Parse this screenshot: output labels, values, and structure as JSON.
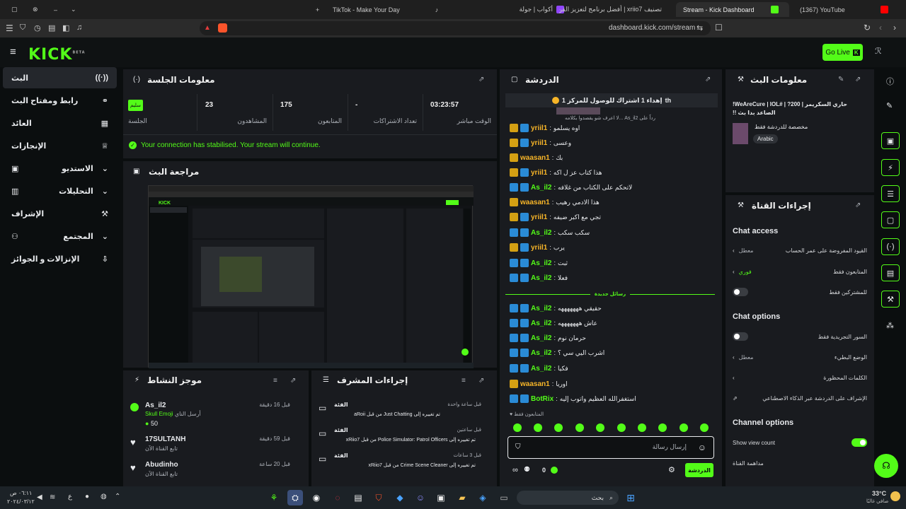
{
  "browser": {
    "tabs": [
      {
        "label": "(1367) YouTube",
        "icon": "youtube-icon",
        "color": "#ff0000"
      },
      {
        "label": "Stream - Kick Dashboard",
        "icon": "kick-icon",
        "color": "#53fc18",
        "active": true
      },
      {
        "label": "تصنيف xriio7 | أفضل برنامج لتعزيز القن...",
        "icon": "rank-icon",
        "color": "#9146ff"
      },
      {
        "label": "أكواب | جولة",
        "icon": "cup-icon",
        "color": "#9146ff"
      },
      {
        "label": "TikTok - Make Your Day",
        "icon": "tiktok-icon",
        "color": "#ffffff"
      }
    ],
    "url": "dashboard.kick.com/stream"
  },
  "header": {
    "logo": "KICK",
    "logo_sup": "BETA",
    "go_live": "Go Live"
  },
  "sidebar": {
    "items": [
      {
        "label": "البث",
        "icon": "broadcast-icon"
      },
      {
        "label": "رابط ومفتاح البث",
        "icon": "link-icon"
      },
      {
        "label": "العائد",
        "icon": "revenue-icon"
      },
      {
        "label": "الإنجازات",
        "icon": "trophy-icon"
      },
      {
        "label": "الاستديو",
        "icon": "studio-icon"
      },
      {
        "label": "التحليلات",
        "icon": "analytics-icon"
      },
      {
        "label": "الإشراف",
        "icon": "moderation-icon"
      },
      {
        "label": "المجتمع",
        "icon": "community-icon"
      },
      {
        "label": "الإنزالات و الجوائز",
        "icon": "drops-icon"
      }
    ]
  },
  "session": {
    "title": "معلومات الجلسة",
    "status_badge": "سليم",
    "status_label": "الجلسة",
    "stats": [
      {
        "value": "23",
        "label": "المشاهدون"
      },
      {
        "value": "175",
        "label": "المتابعون"
      },
      {
        "value": "-",
        "label": "تعداد الاشتراكات"
      },
      {
        "value": "03:23:57",
        "label": "الوقت مباشر"
      }
    ],
    "notice": "Your connection has stabilised. Your stream will continue."
  },
  "preview": {
    "title": "مراجعة البث"
  },
  "activity": {
    "title": "موجز النشاط",
    "items": [
      {
        "user": "As_il2",
        "detail": "أرسل الناي",
        "detail2": "Skull Emoji",
        "amount": "50",
        "time": "قبل 16 دقيقة",
        "icon": "kick-coin-icon"
      },
      {
        "user": "17SULTANH",
        "detail": "تابع القناة الآن",
        "time": "قبل 59 دقيقة",
        "icon": "heart-icon"
      },
      {
        "user": "Abudinho",
        "detail": "تابع القناة الآن",
        "time": "قبل 20 ساعة",
        "icon": "heart-icon"
      }
    ]
  },
  "modactions": {
    "title": "إجراءات المشرف",
    "items": [
      {
        "heading": "الفئة",
        "text": "تم تغييره إلى Just Chatting من قبل aRoii",
        "time": "قبل ساعة واحدة"
      },
      {
        "heading": "الفئة",
        "text": "تم تغييره إلى Police Simulator: Patrol Officers من قبل xRiio7",
        "time": "قبل ساعتين"
      },
      {
        "heading": "الفئة",
        "text": "تم تغييره إلى Crime Scene Cleaner من قبل xRiio7",
        "time": "قبل 3 ساعات"
      }
    ]
  },
  "chat": {
    "title": "الدردشة",
    "pinned": "إهداء 1 اشتراك للوصول للمركز 1",
    "pinned_user": "th",
    "pinned_sub": "لا اعرف شو يقصدوا بكلامه... As_il2 رداً على",
    "new_messages": "رسائل جديدة",
    "messages": [
      {
        "user": "yriil1",
        "text": "اوه يسلمو",
        "color": "#f7b528"
      },
      {
        "user": "yriil1",
        "text": "وعسى",
        "color": "#f7b528"
      },
      {
        "user": "waasan1",
        "text": "بك",
        "color": "#f7b528"
      },
      {
        "user": "yriil1",
        "text": "هذا كتاب عز ل اكه",
        "color": "#f7b528"
      },
      {
        "user": "As_il2",
        "text": "لاتحكم على الكتاب من غلافه",
        "color": "#53fc18"
      },
      {
        "user": "waasan1",
        "text": "هذا الادمي رهيب",
        "color": "#f7b528"
      },
      {
        "user": "yriil1",
        "text": "تجي مع اكبر ضيفه",
        "color": "#f7b528"
      },
      {
        "user": "As_il2",
        "text": "سكب سكب",
        "color": "#53fc18"
      },
      {
        "user": "yriil1",
        "text": "يرب",
        "color": "#f7b528"
      },
      {
        "user": "As_il2",
        "text": "ثبت",
        "color": "#53fc18"
      },
      {
        "user": "As_il2",
        "text": "فعلا",
        "color": "#53fc18"
      },
      {
        "user": "As_il2",
        "text": "حقيقي هههههههه",
        "color": "#53fc18"
      },
      {
        "user": "As_il2",
        "text": "عاش هههههههه",
        "color": "#53fc18"
      },
      {
        "user": "As_il2",
        "text": "حرمان نوم",
        "color": "#53fc18"
      },
      {
        "user": "As_il2",
        "text": "اشرب اليي سي ؟",
        "color": "#53fc18"
      },
      {
        "user": "As_il2",
        "text": "فكيا",
        "color": "#53fc18"
      },
      {
        "user": "waasan1",
        "text": "اوريا",
        "color": "#f7b528"
      },
      {
        "user": "BotRix",
        "text": "استغفرالله العظيم واتوب إليه",
        "color": "#53fc18"
      }
    ],
    "followers_only": "المتابعون فقط",
    "input_placeholder": "إرسال رسالة",
    "send_label": "الدردشة",
    "counter": "0"
  },
  "streaminfo": {
    "title": "معلومات البث",
    "stream_title": "حاري السكريمر | 200? | #WeAreCure | IOL! الصاعد بدا بث !!",
    "category": "مخصصة للدردشة فقط",
    "language": "Arabic"
  },
  "channelactions": {
    "title": "إجراءات القناة",
    "chat_access": "Chat access",
    "chat_options": "Chat options",
    "channel_options": "Channel options",
    "rows_access": [
      {
        "label": "القيود المفروضة على عمر الحساب",
        "value": "معطل",
        "type": "chevron"
      },
      {
        "label": "المتابعون فقط",
        "value": "فوري",
        "type": "chevron-green"
      },
      {
        "label": "للمشتركين فقط",
        "value": "",
        "type": "toggle-off"
      }
    ],
    "rows_options": [
      {
        "label": "السور التجريدية فقط",
        "value": "",
        "type": "toggle-off"
      },
      {
        "label": "الوضع البطيء",
        "value": "معطل",
        "type": "chevron"
      },
      {
        "label": "الكلمات المحظورة",
        "value": "",
        "type": "chevron"
      },
      {
        "label": "الإشراف على الدردشة عبر الذكاء الاصطناعي",
        "value": "",
        "type": "external"
      }
    ],
    "rows_channel": [
      {
        "label": "Show view count",
        "value": "",
        "type": "toggle-on"
      },
      {
        "label": "مداهمة القناة",
        "value": "",
        "type": "none"
      }
    ]
  },
  "taskbar": {
    "search": "بحث",
    "time": "٠٦:١١ ص",
    "date": "٢٠٢٤/٠٣/١٢",
    "weather": "33°C",
    "weather_sub": "صافي غالبًا",
    "lang": "ع"
  },
  "colors": {
    "accent": "#53fc18",
    "panel": "#191b1f",
    "bg": "#0b0e0f"
  }
}
